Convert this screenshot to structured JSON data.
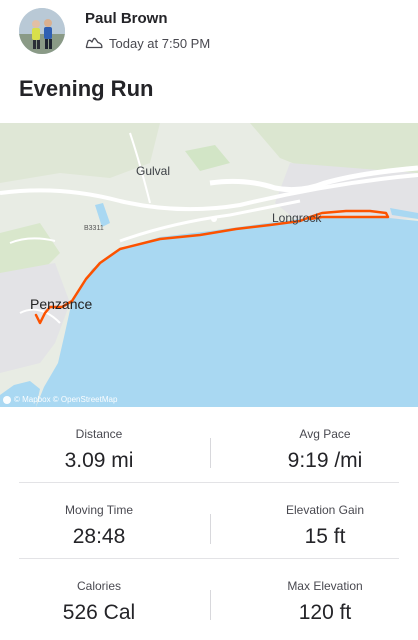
{
  "athlete": {
    "name": "Paul Brown",
    "avatar_icon": "avatar-photo"
  },
  "activity": {
    "type_icon": "shoe-icon",
    "timestamp": "Today at 7:50 PM",
    "title": "Evening Run"
  },
  "map": {
    "labels": {
      "gulval": "Gulval",
      "longrock": "Longrock",
      "penzance": "Penzance",
      "road": "B3311"
    },
    "attribution": "© Mapbox © OpenStreetMap",
    "route_color": "#fc5200",
    "sea_color": "#a9d8f2"
  },
  "stats": [
    {
      "left": {
        "label": "Distance",
        "value": "3.09 mi"
      },
      "right": {
        "label": "Avg Pace",
        "value": "9:19 /mi"
      }
    },
    {
      "left": {
        "label": "Moving Time",
        "value": "28:48"
      },
      "right": {
        "label": "Elevation Gain",
        "value": "15 ft"
      }
    },
    {
      "left": {
        "label": "Calories",
        "value": "526 Cal"
      },
      "right": {
        "label": "Max Elevation",
        "value": "120 ft"
      }
    }
  ]
}
